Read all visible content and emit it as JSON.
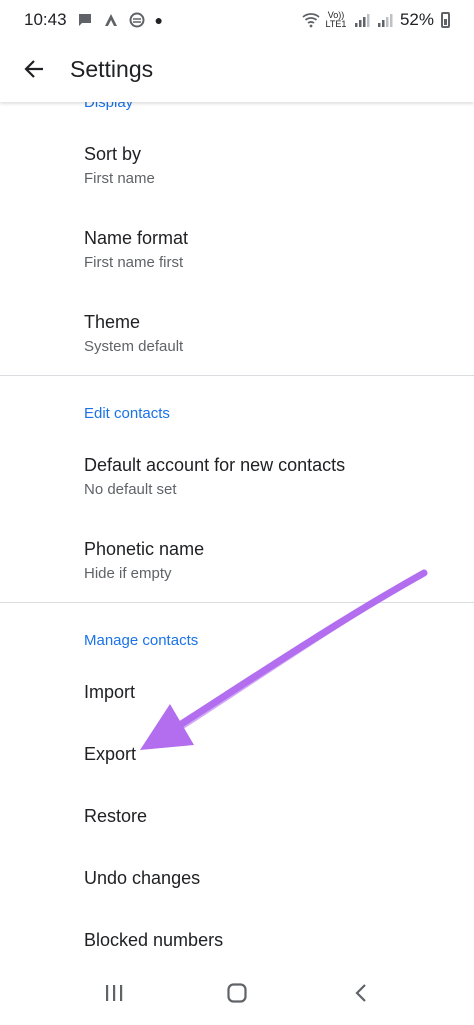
{
  "status": {
    "time": "10:43",
    "volte_line1": "Vo))",
    "volte_line2": "LTE1",
    "battery": "52%"
  },
  "header": {
    "title": "Settings"
  },
  "sections": {
    "display": {
      "header": "Display",
      "sort_by": {
        "title": "Sort by",
        "subtitle": "First name"
      },
      "name_format": {
        "title": "Name format",
        "subtitle": "First name first"
      },
      "theme": {
        "title": "Theme",
        "subtitle": "System default"
      }
    },
    "edit_contacts": {
      "header": "Edit contacts",
      "default_account": {
        "title": "Default account for new contacts",
        "subtitle": "No default set"
      },
      "phonetic_name": {
        "title": "Phonetic name",
        "subtitle": "Hide if empty"
      }
    },
    "manage_contacts": {
      "header": "Manage contacts",
      "items": [
        "Import",
        "Export",
        "Restore",
        "Undo changes",
        "Blocked numbers"
      ]
    }
  },
  "colors": {
    "accent": "#1a73e8",
    "arrow": "#b36ef0"
  },
  "icons": {
    "back": "arrow-left-icon",
    "nav_recents": "recents-icon",
    "nav_home": "home-icon",
    "nav_back": "nav-back-icon"
  }
}
